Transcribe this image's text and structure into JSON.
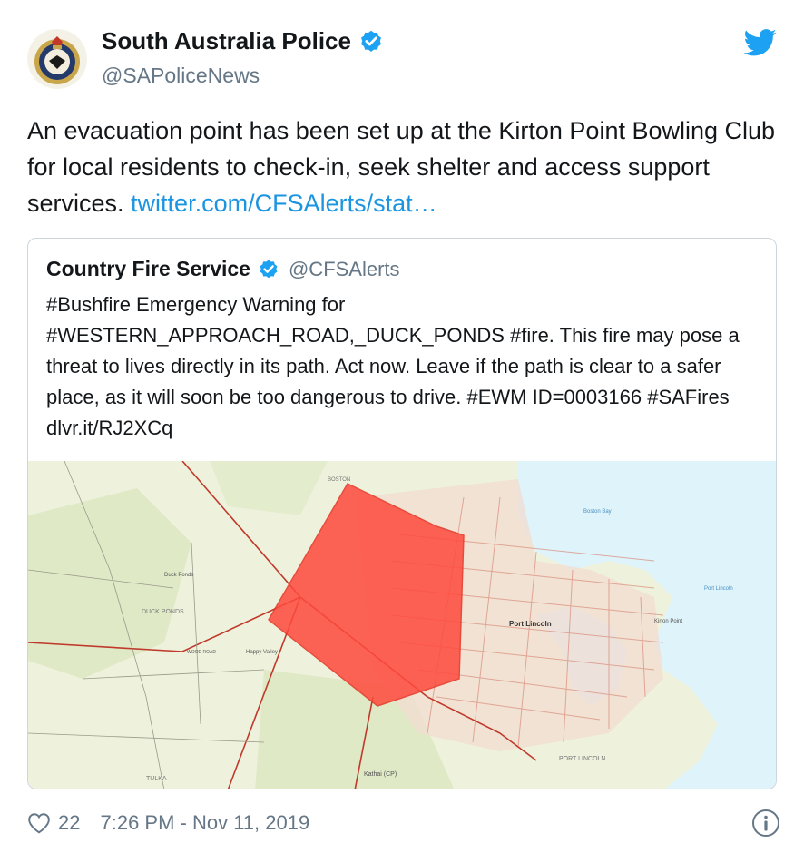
{
  "author": {
    "name": "South Australia Police",
    "handle": "@SAPoliceNews",
    "verified": true
  },
  "tweet": {
    "text": "An evacuation point has been set up at the Kirton Point Bowling Club for local residents to check-in, seek shelter and access support services.",
    "link": "twitter.com/CFSAlerts/stat…"
  },
  "quoted_tweet": {
    "name": "Country Fire Service",
    "handle": "@CFSAlerts",
    "verified": true,
    "text": "#Bushfire Emergency Warning for #WESTERN_APPROACH_ROAD,_DUCK_PONDS #fire. This fire may pose a threat to lives directly in its path. Act now. Leave if the path is clear to a safer place, as it will soon be too dangerous to drive. #EWM ID=0003166 #SAFires dlvr.it/RJ2XCq",
    "map_labels": {
      "port_lincoln": "Port Lincoln",
      "duck_ponds": "DUCK PONDS",
      "duck_ponds_place": "Duck Ponds",
      "tulka": "TULKA",
      "kathai": "Kathai (CP)",
      "port_lincoln_region": "PORT LINCOLN",
      "boston": "BOSTON",
      "boston_bay": "Boston Bay",
      "woodroad": "WOOD ROAD",
      "kirton_point": "Kirton Point",
      "happy_valley": "Happy Valley",
      "port_lincoln_bay": "Port Lincoln"
    }
  },
  "footer": {
    "likes": "22",
    "timestamp": "7:26 PM - Nov 11, 2019"
  },
  "icons": {
    "verified": "verified-badge-icon",
    "twitter": "twitter-bird-icon",
    "heart": "heart-icon",
    "info": "info-icon"
  },
  "colors": {
    "twitter_blue": "#1da1f2",
    "link_blue": "#1b95e0",
    "fire_zone": "#ff4a3d",
    "water": "#dff3fa",
    "land": "#eef2dc"
  }
}
